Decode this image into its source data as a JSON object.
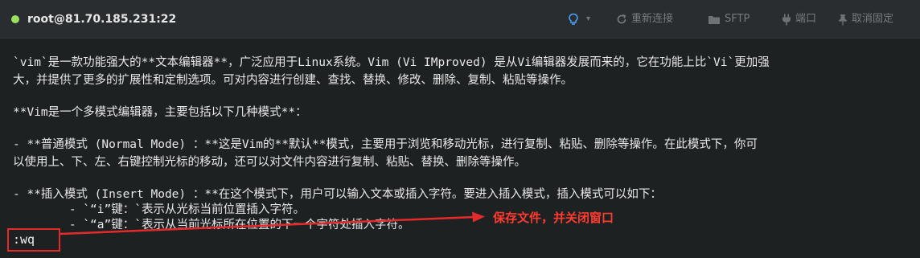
{
  "header": {
    "connection": "root@81.70.185.231:22",
    "status_color": "#9be15d",
    "toolbar": {
      "reconnect": "重新连接",
      "sftp": "SFTP",
      "port": "端口",
      "unpin": "取消固定"
    }
  },
  "terminal": {
    "lines": [
      "`vim`是一款功能强大的**文本编辑器**，广泛应用于Linux系统。Vim (Vi IMproved) 是从Vi编辑器发展而来的，它在功能上比`Vi`更加强",
      "大，并提供了更多的扩展性和定制选项。可对内容进行创建、查找、替换、修改、删除、复制、粘贴等操作。",
      "**Vim是一个多模式编辑器，主要包括以下几种模式**：",
      "- **普通模式 (Normal Mode) ：**这是Vim的**默认**模式，主要用于浏览和移动光标，进行复制、粘贴、删除等操作。在此模式下，你可",
      "以使用上、下、左、右键控制光标的移动，还可以对文件内容进行复制、粘贴、替换、删除等操作。",
      "- **插入模式 (Insert Mode) ：**在这个模式下，用户可以输入文本或插入字符。要进入插入模式，插入模式可以如下：",
      "        - `“i”键：`表示从光标当前位置插入字符。",
      "        - `“a”键：`表示从当前光标所在位置的下一个字符处插入字符。"
    ],
    "command": ":wq"
  },
  "annotation": {
    "label": "保存文件，并关闭窗口",
    "color": "#e52a2a"
  }
}
